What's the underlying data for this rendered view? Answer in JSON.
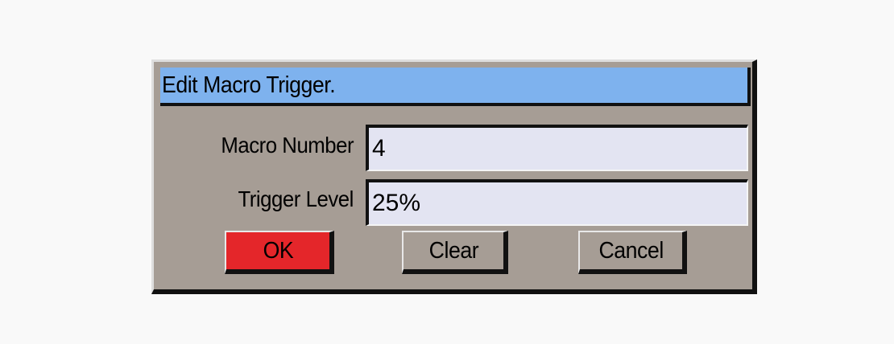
{
  "dialog": {
    "title": "Edit Macro Trigger."
  },
  "fields": {
    "macro_number": {
      "label": "Macro Number",
      "value": "4"
    },
    "trigger_level": {
      "label": "Trigger Level",
      "value": "25%"
    }
  },
  "buttons": {
    "ok": "OK",
    "clear": "Clear",
    "cancel": "Cancel"
  },
  "colors": {
    "title_bar": "#7eb2ee",
    "dialog_background": "#a69d95",
    "ok_button": "#e4262a",
    "field_background": "#e3e4f2"
  }
}
